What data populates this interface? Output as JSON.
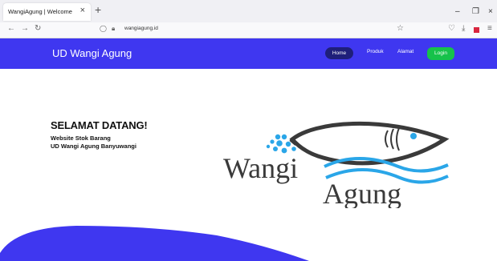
{
  "browser": {
    "tab_title": "WangiAgung | Welcome",
    "url": "wangiagung.id"
  },
  "site": {
    "brand": "UD Wangi Agung",
    "nav": {
      "home": "Home",
      "produk": "Produk",
      "alamat": "Alamat",
      "login": "Login"
    }
  },
  "hero": {
    "title": "SELAMAT DATANG!",
    "line1": "Website Stok Barang",
    "line2": "UD Wangi Agung Banyuwangi"
  },
  "logo": {
    "word1": "Wangi",
    "word2": "Agung"
  },
  "colors": {
    "nav_bg": "#3f37f0",
    "home_pill": "#1f1f7a",
    "login_btn": "#16c24a",
    "wave": "#3f37f0",
    "logo_blue": "#2aa6e8",
    "logo_dark": "#3a3a3a"
  }
}
